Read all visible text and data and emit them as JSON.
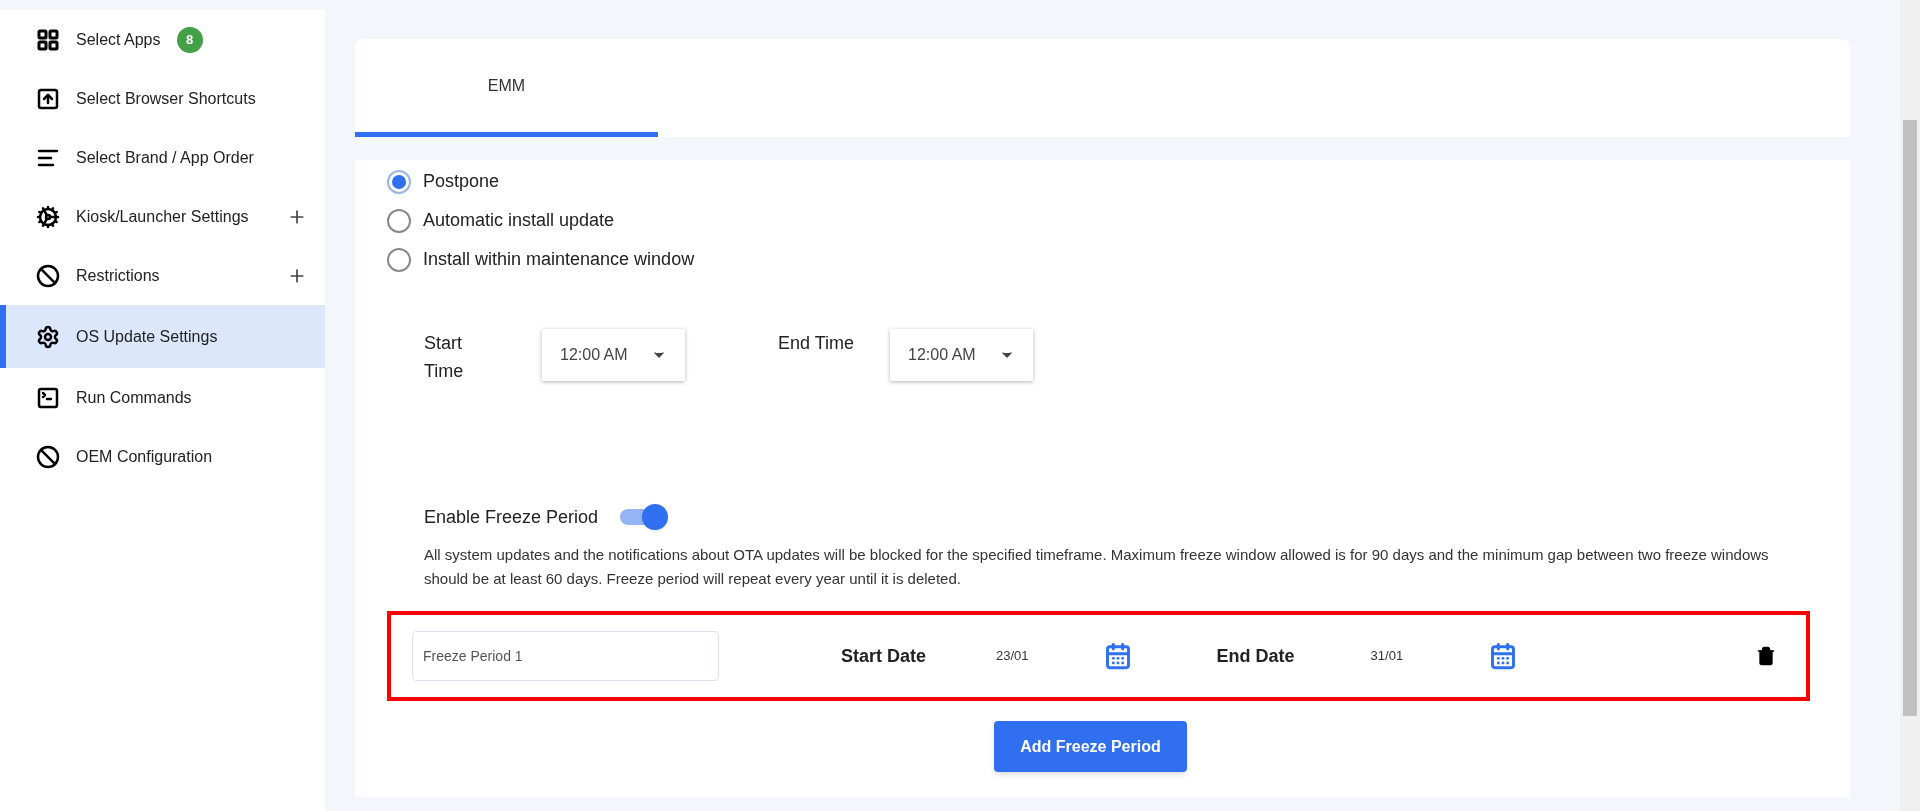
{
  "sidebar": {
    "items": [
      {
        "label": "Select Apps",
        "kind": "grid",
        "badge": "8",
        "expandable": false,
        "selected": false
      },
      {
        "label": "Select Browser Shortcuts",
        "kind": "shortcut",
        "expandable": false,
        "selected": false
      },
      {
        "label": "Select Brand / App Order",
        "kind": "sort",
        "expandable": false,
        "selected": false
      },
      {
        "label": "Kiosk/Launcher Settings",
        "kind": "settings",
        "expandable": true,
        "selected": false
      },
      {
        "label": "Restrictions",
        "kind": "block",
        "expandable": true,
        "selected": false
      },
      {
        "label": "OS Update Settings",
        "kind": "gear",
        "expandable": false,
        "selected": true
      },
      {
        "label": "Run Commands",
        "kind": "terminal",
        "expandable": false,
        "selected": false
      },
      {
        "label": "OEM Configuration",
        "kind": "block",
        "expandable": false,
        "selected": false
      }
    ]
  },
  "tabs": [
    {
      "label": "EMM",
      "selected": true
    }
  ],
  "update_policy": {
    "options": [
      {
        "label": "Postpone",
        "selected": true
      },
      {
        "label": "Automatic install update",
        "selected": false
      },
      {
        "label": "Install within maintenance window",
        "selected": false
      }
    ]
  },
  "maintenance_window": {
    "start_label": "Start Time",
    "start_value": "12:00 AM",
    "end_label": "End Time",
    "end_value": "12:00 AM"
  },
  "freeze": {
    "label": "Enable Freeze Period",
    "on": true,
    "description": "All system updates and the notifications about OTA updates will be blocked for the specified timeframe. Maximum freeze window allowed is for 90 days and the minimum gap between two freeze windows should be at least 60 days. Freeze period will repeat every year until it is deleted.",
    "periods": [
      {
        "name": "Freeze Period 1",
        "start_label": "Start Date",
        "start_value": "23/01",
        "end_label": "End Date",
        "end_value": "31/01"
      }
    ],
    "add_button": "Add Freeze Period"
  }
}
